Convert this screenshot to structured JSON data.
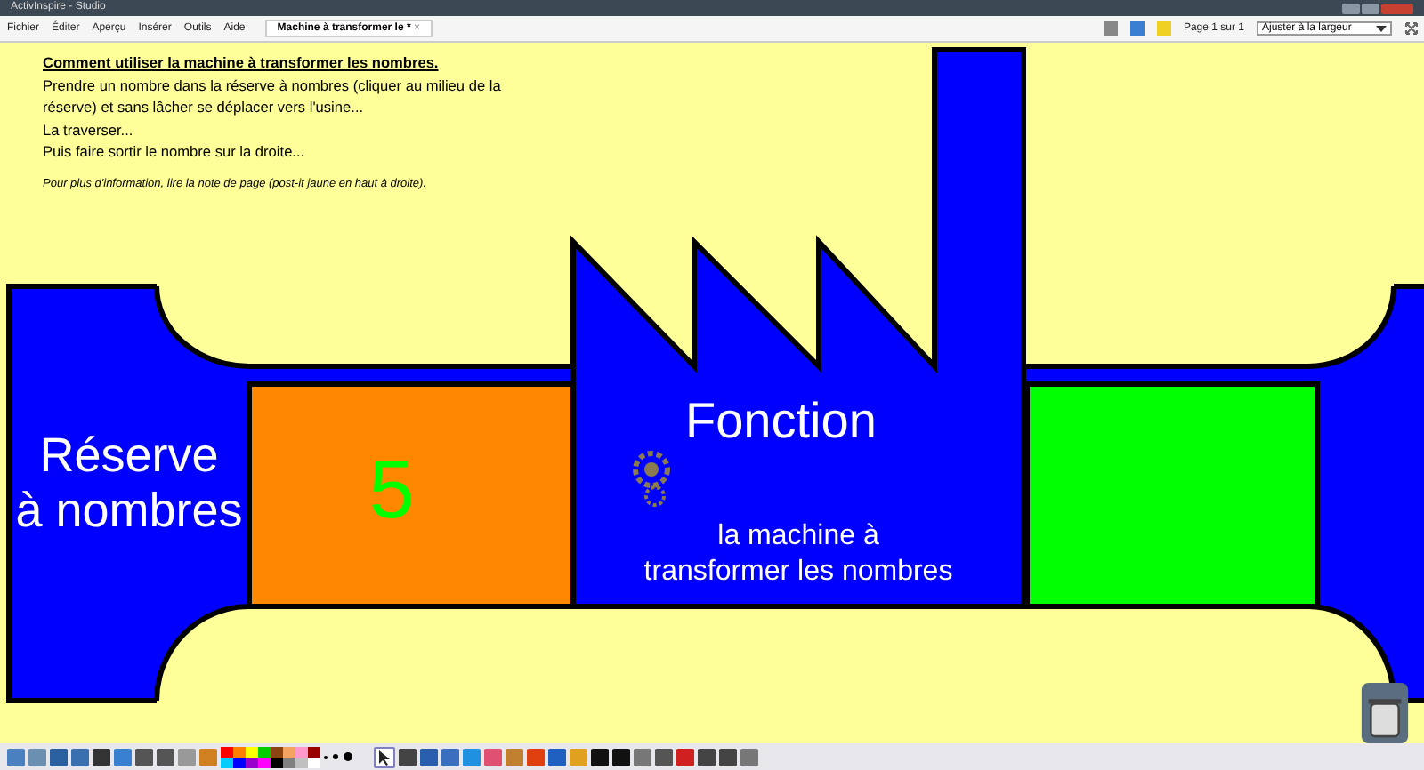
{
  "window": {
    "title": "ActivInspire - Studio"
  },
  "menu": [
    "Fichier",
    "Éditer",
    "Aperçu",
    "Insérer",
    "Outils",
    "Aide"
  ],
  "document_tab": {
    "label": "Machine à transformer le *",
    "close": "×"
  },
  "page_indicator": "Page 1 sur 1",
  "zoom_select": {
    "value": "Ajuster à la largeur"
  },
  "instructions": {
    "heading": "Comment utiliser la machine à transformer les nombres.",
    "lines": [
      "Prendre un nombre dans la réserve à nombres (cliquer au milieu de la réserve) et sans lâcher se déplacer vers l'usine...",
      "La traverser...",
      "Puis faire sortir le nombre sur la droite..."
    ],
    "note": "Pour plus d'information, lire la note de page (post-it jaune en haut à droite)."
  },
  "diagram": {
    "reserve_label": "Réserve\nà nombres",
    "number": "5",
    "factory_title": "Fonction",
    "factory_subtitle": "la machine à\ntransformer les nombres"
  },
  "palette": [
    {
      "color": "#ff0000"
    },
    {
      "color": "#ff8000"
    },
    {
      "color": "#ffff00"
    },
    {
      "color": "#00cc00"
    },
    {
      "color": "#8b4513"
    },
    {
      "color": "#f4a460"
    },
    {
      "color": "#ff99cc"
    },
    {
      "color": "#990000"
    },
    {
      "color": "#00ccff"
    },
    {
      "color": "#0000ff"
    },
    {
      "color": "#9900cc"
    },
    {
      "color": "#ff00ff"
    },
    {
      "color": "#000000"
    },
    {
      "color": "#808080"
    },
    {
      "color": "#c0c0c0"
    },
    {
      "color": "#ffffff"
    }
  ]
}
